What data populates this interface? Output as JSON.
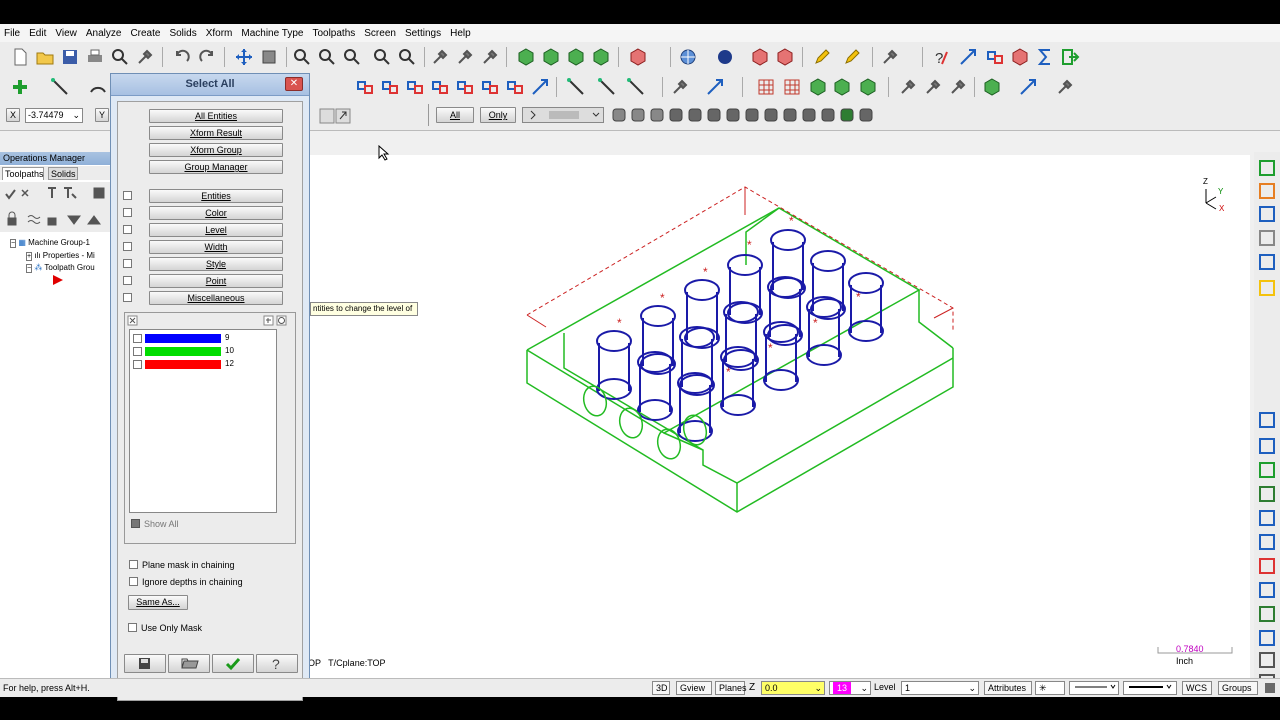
{
  "menu": [
    "File",
    "Edit",
    "View",
    "Analyze",
    "Create",
    "Solids",
    "Xform",
    "Machine Type",
    "Toolpaths",
    "Screen",
    "Settings",
    "Help"
  ],
  "coord": {
    "x_label": "X",
    "x_value": "-3.74479",
    "y_label": "Y"
  },
  "selection_bar": {
    "all_label": "All",
    "only_label": "Only"
  },
  "ops_manager": {
    "title": "Operations Manager",
    "tab_toolpaths": "Toolpaths",
    "tab_solids": "Solids",
    "tree": [
      "Machine Group-1",
      "Properties - Mi",
      "Toolpath Grou"
    ]
  },
  "dialog": {
    "title": "Select All",
    "group1": [
      "All Entities",
      "Xform Result",
      "Xform Group",
      "Group Manager"
    ],
    "group2": [
      "Entities",
      "Color",
      "Level",
      "Width",
      "Style",
      "Point",
      "Miscellaneous"
    ],
    "levels": [
      {
        "name": "9",
        "color": "#0000ff"
      },
      {
        "name": "10",
        "color": "#00dd00"
      },
      {
        "name": "12",
        "color": "#ff0000"
      }
    ],
    "show_all": "Show All",
    "plane_mask": "Plane mask in chaining",
    "ignore_depths": "Ignore depths in chaining",
    "same_as": "Same As...",
    "use_only_mask": "Use Only Mask"
  },
  "tooltip": "ntities to change the level of",
  "viewport": {
    "plane_info": "OP   T/Cplane:TOP",
    "scale_value": "0.7840",
    "scale_unit": "Inch",
    "axis_z": "Z",
    "axis_y": "Y",
    "axis_x": "X"
  },
  "status": {
    "help": "For help, press Alt+H.",
    "btn_3d": "3D",
    "gview": "Gview",
    "planes": "Planes",
    "z_label": "Z",
    "z_value": "0.0",
    "color_value": "13",
    "level_label": "Level",
    "level_value": "1",
    "attributes": "Attributes",
    "wcs": "WCS",
    "groups": "Groups"
  },
  "colors": {
    "part_green": "#22bb22",
    "hole_blue": "#1a1aa8",
    "dim_red": "#cc2222",
    "level_bar_blue": "#0000ff",
    "level_bar_green": "#00dd00",
    "level_bar_red": "#ff0000",
    "color_swatch": "#ff00ff",
    "z_field": "#ffff66"
  }
}
